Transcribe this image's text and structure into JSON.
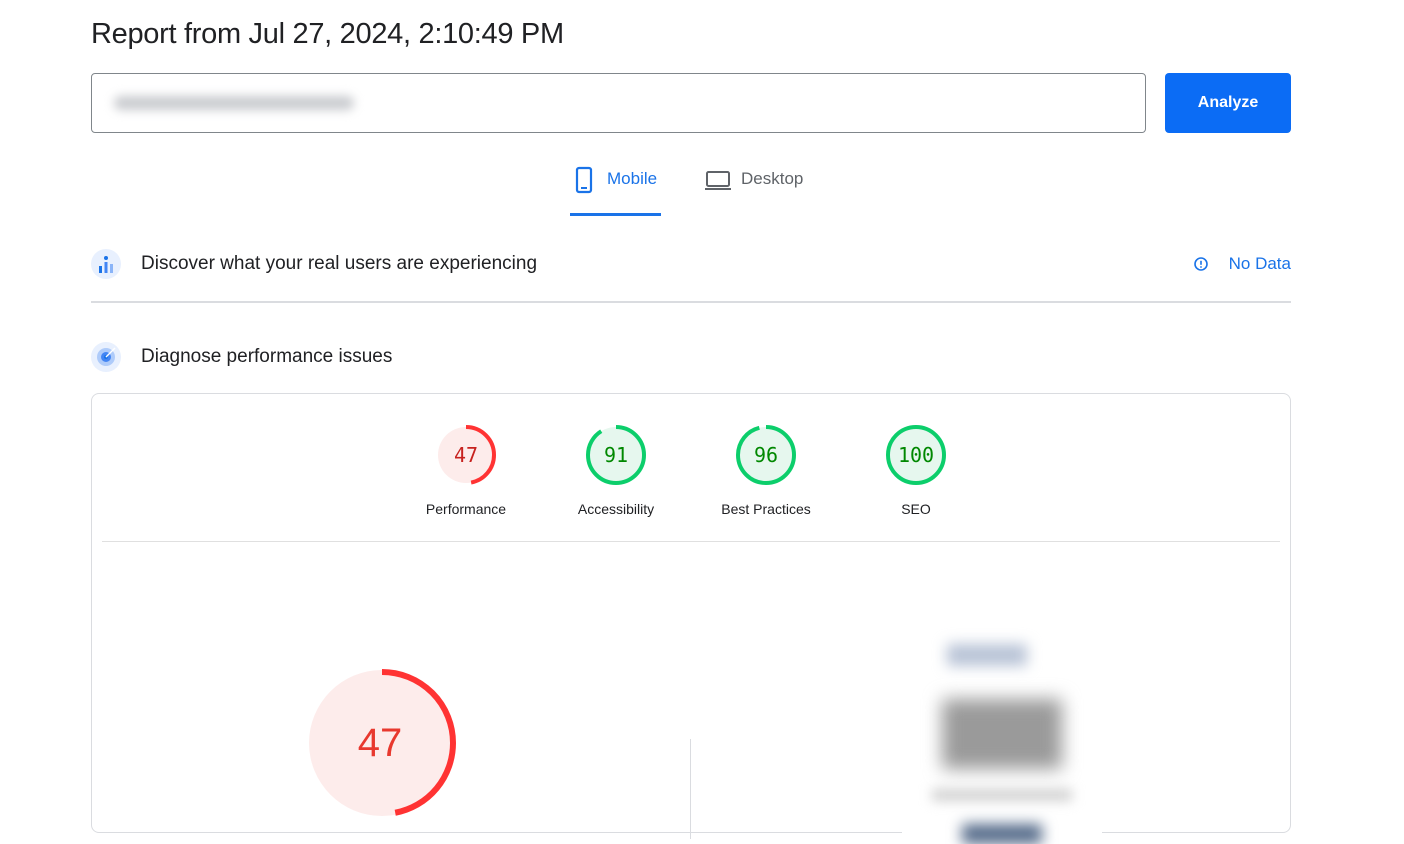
{
  "report": {
    "title": "Report from Jul 27, 2024, 2:10:49 PM"
  },
  "url_input": {
    "value": ""
  },
  "analyze_button": {
    "label": "Analyze"
  },
  "tabs": [
    {
      "label": "Mobile",
      "icon": "phone-icon",
      "selected": true
    },
    {
      "label": "Desktop",
      "icon": "laptop-icon",
      "selected": false
    }
  ],
  "real_users": {
    "title": "Discover what your real users are experiencing",
    "status": "No Data",
    "icon": "crux-chart-icon"
  },
  "diagnose": {
    "title": "Diagnose performance issues",
    "icon": "lighthouse-target-icon"
  },
  "categories": [
    {
      "label": "Performance",
      "score": "47",
      "status": "fail",
      "color": "#ff3333",
      "fill": "#fdeceb",
      "text_color": "#c7221f"
    },
    {
      "label": "Accessibility",
      "score": "91",
      "status": "pass",
      "color": "#0cce6b",
      "fill": "#e6f7ee",
      "text_color": "#008800"
    },
    {
      "label": "Best Practices",
      "score": "96",
      "status": "pass",
      "color": "#0cce6b",
      "fill": "#e6f7ee",
      "text_color": "#008800"
    },
    {
      "label": "SEO",
      "score": "100",
      "status": "pass",
      "color": "#0cce6b",
      "fill": "#e6f7ee",
      "text_color": "#008800"
    }
  ],
  "main_score": {
    "score": "47",
    "color": "#ff3333",
    "fill": "#fdeceb",
    "text_color": "#e8382e"
  },
  "colors": {
    "accent": "#1a73e8",
    "analyze_button": "#0b6cf5",
    "fail": "#ff3333",
    "pass": "#0cce6b"
  }
}
